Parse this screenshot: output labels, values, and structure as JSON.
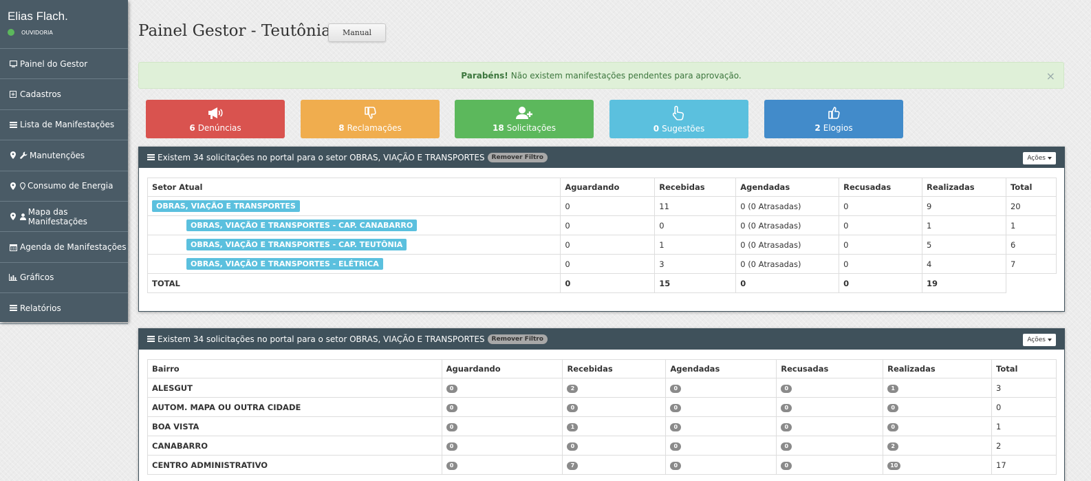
{
  "user": {
    "name": "Elias Flach.",
    "role": "OUVIDORIA",
    "status_color": "#5cb85c"
  },
  "sidebar": {
    "items": [
      {
        "label": "Painel do Gestor",
        "icon": "monitor-icon"
      },
      {
        "label": "Cadastros",
        "icon": "plus-square-icon"
      },
      {
        "label": "Lista de Manifestações",
        "icon": "list-icon"
      },
      {
        "label": "Manutenções",
        "icon": "wrench-icon"
      },
      {
        "label": "Consumo de Energia",
        "icon": "map-marker-icon"
      },
      {
        "label": "Mapa das Manifestações",
        "icon": "user-icon"
      },
      {
        "label": "Agenda de Manifestações",
        "icon": "calendar-icon"
      },
      {
        "label": "Gráficos",
        "icon": "bar-chart-icon"
      },
      {
        "label": "Relatórios",
        "icon": "list-icon"
      }
    ]
  },
  "header": {
    "title": "Painel Gestor - Teutônia",
    "manual_label": "Manual"
  },
  "alert": {
    "strong": "Parabéns!",
    "text": "Não existem manifestações pendentes para aprovação.",
    "close": "×"
  },
  "tiles": [
    {
      "count": "6",
      "label": "Denúncias",
      "color": "#d9534f",
      "icon": "megaphone-icon"
    },
    {
      "count": "8",
      "label": "Reclamações",
      "color": "#f0ad4e",
      "icon": "thumbs-down-icon"
    },
    {
      "count": "18",
      "label": "Solicitações",
      "color": "#5cb85c",
      "icon": "user-plus-icon"
    },
    {
      "count": "0",
      "label": "Sugestões",
      "color": "#5bc0de",
      "icon": "pointing-hand-icon"
    },
    {
      "count": "2",
      "label": "Elogios",
      "color": "#428bca",
      "icon": "thumbs-up-icon"
    }
  ],
  "panel1": {
    "heading": "Existem 34 solicitações no portal para o setor OBRAS, VIAÇÃO E TRANSPORTES",
    "filter_label": "Remover Filtro",
    "actions_label": "Ações",
    "columns": [
      "Setor Atual",
      "Aguardando",
      "Recebidas",
      "Agendadas",
      "Recusadas",
      "Realizadas",
      "Total"
    ],
    "rows": [
      {
        "setor": "OBRAS, VIAÇÃO E TRANSPORTES",
        "aguardando": "0",
        "recebidas": "11",
        "agendadas": "0 (0 Atrasadas)",
        "recusadas": "0",
        "realizadas": "9",
        "total": "20"
      },
      {
        "setor": "OBRAS, VIAÇÃO E TRANSPORTES - CAP. CANABARRO",
        "aguardando": "0",
        "recebidas": "0",
        "agendadas": "0 (0 Atrasadas)",
        "recusadas": "0",
        "realizadas": "1",
        "total": "1"
      },
      {
        "setor": "OBRAS, VIAÇÃO E TRANSPORTES - CAP. TEUTÔNIA",
        "aguardando": "0",
        "recebidas": "1",
        "agendadas": "0 (0 Atrasadas)",
        "recusadas": "0",
        "realizadas": "5",
        "total": "6"
      },
      {
        "setor": "OBRAS, VIAÇÃO E TRANSPORTES - ELÉTRICA",
        "aguardando": "0",
        "recebidas": "3",
        "agendadas": "0 (0 Atrasadas)",
        "recusadas": "0",
        "realizadas": "4",
        "total": "7"
      }
    ],
    "total": {
      "label": "TOTAL",
      "aguardando": "0",
      "recebidas": "15",
      "agendadas": "0",
      "recusadas": "0",
      "realizadas": "19"
    }
  },
  "panel2": {
    "heading": "Existem 34 solicitações no portal para o setor OBRAS, VIAÇÃO E TRANSPORTES",
    "filter_label": "Remover Filtro",
    "actions_label": "Ações",
    "columns": [
      "Bairro",
      "Aguardando",
      "Recebidas",
      "Agendadas",
      "Recusadas",
      "Realizadas",
      "Total"
    ],
    "rows": [
      {
        "bairro": "ALESGUT",
        "aguardando": "0",
        "recebidas": "2",
        "agendadas": "0",
        "recusadas": "0",
        "realizadas": "1",
        "total": "3"
      },
      {
        "bairro": "AUTOM. MAPA OU OUTRA CIDADE",
        "aguardando": "0",
        "recebidas": "0",
        "agendadas": "0",
        "recusadas": "0",
        "realizadas": "0",
        "total": "0"
      },
      {
        "bairro": "BOA VISTA",
        "aguardando": "0",
        "recebidas": "1",
        "agendadas": "0",
        "recusadas": "0",
        "realizadas": "0",
        "total": "1"
      },
      {
        "bairro": "CANABARRO",
        "aguardando": "0",
        "recebidas": "0",
        "agendadas": "0",
        "recusadas": "0",
        "realizadas": "2",
        "total": "2"
      },
      {
        "bairro": "CENTRO ADMINISTRATIVO",
        "aguardando": "0",
        "recebidas": "7",
        "agendadas": "0",
        "recusadas": "0",
        "realizadas": "10",
        "total": "17"
      }
    ]
  }
}
